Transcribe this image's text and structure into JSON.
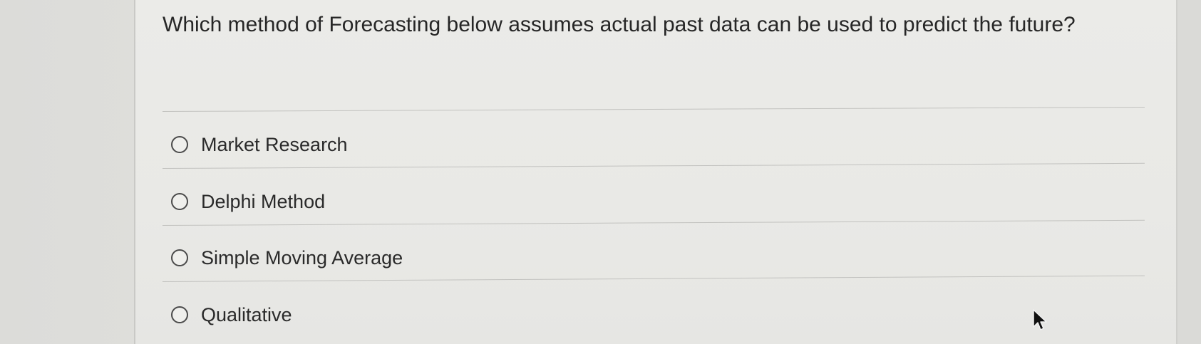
{
  "question": {
    "text": "Which method of Forecasting below assumes actual past data can be used to predict the future?"
  },
  "options": [
    {
      "label": "Market Research",
      "selected": false
    },
    {
      "label": "Delphi Method",
      "selected": false
    },
    {
      "label": "Simple Moving Average",
      "selected": false
    },
    {
      "label": "Qualitative",
      "selected": false
    }
  ],
  "cursor": {
    "icon": "mouse-pointer-icon"
  }
}
